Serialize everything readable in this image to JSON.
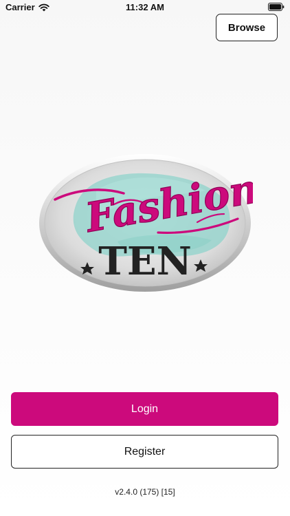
{
  "status_bar": {
    "carrier": "Carrier",
    "time": "11:32 AM",
    "wifi_icon": "wifi-icon",
    "battery_icon": "battery-icon"
  },
  "header": {
    "browse_label": "Browse"
  },
  "logo": {
    "wordmark_top": "Fashion",
    "wordmark_bottom": "TEN",
    "colors": {
      "pink": "#cc0a7c",
      "teal": "#8fd3cb",
      "dark": "#222222",
      "silver": "#d9d9d9"
    }
  },
  "actions": {
    "login_label": "Login",
    "register_label": "Register"
  },
  "footer": {
    "version": "v2.4.0 (175) [15]"
  }
}
